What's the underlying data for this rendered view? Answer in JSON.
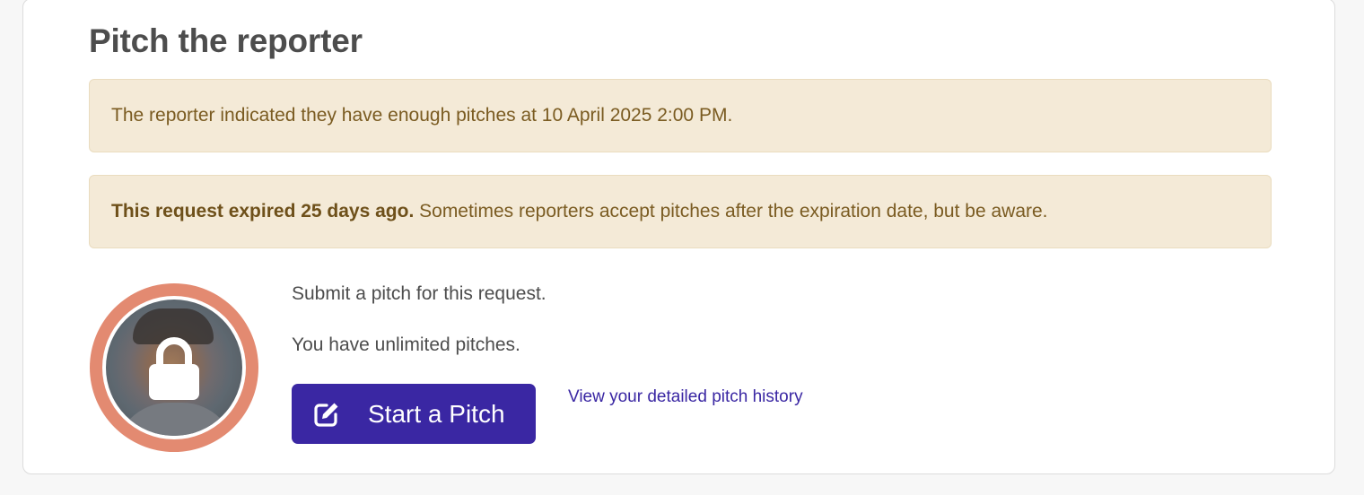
{
  "section": {
    "title": "Pitch the reporter"
  },
  "alerts": {
    "enough_pitches": "The reporter indicated they have enough pitches at 10 April 2025 2:00 PM.",
    "expired_bold": "This request expired 25 days ago.",
    "expired_rest": " Sometimes reporters accept pitches after the expiration date, but be aware."
  },
  "pitch": {
    "submit_text": "Submit a pitch for this request.",
    "unlimited_text": "You have unlimited pitches.",
    "start_button_label": "Start a Pitch",
    "start_button_icon": "edit-icon",
    "history_link": "View your detailed pitch history"
  },
  "avatar": {
    "icon": "lock-icon",
    "ring_color": "#e38a71"
  },
  "colors": {
    "primary": "#3a27a3",
    "alert_background": "#f4ead7",
    "alert_text": "#7a5b21",
    "heading_text": "#4d4d4d"
  }
}
